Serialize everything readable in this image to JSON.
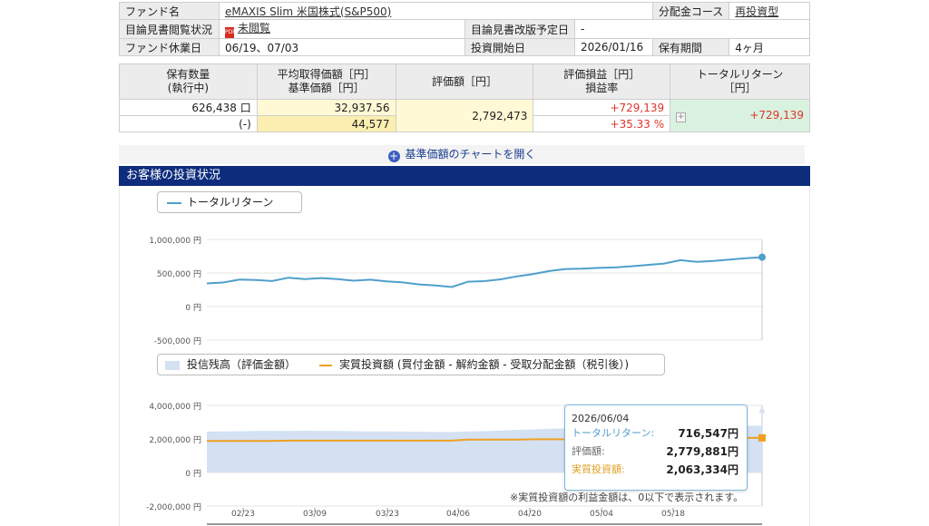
{
  "info": {
    "fund_name_label": "ファンド名",
    "fund_name": "eMAXIS Slim 米国株式(S&P500)",
    "dist_label": "分配金コース",
    "dist_value": "再投資型",
    "prospectus_label": "目論見書閲覧状況",
    "prospectus_status": "未閲覧",
    "revision_label": "目論見書改版予定日",
    "revision_value": "-",
    "holiday_label": "ファンド休業日",
    "holiday_value": "06/19、07/03",
    "start_label": "投資開始日",
    "start_value": "2026/01/16",
    "period_label": "保有期間",
    "period_value": "4ヶ月"
  },
  "holdings": {
    "h_qty1": "保有数量",
    "h_qty2": "(執行中)",
    "h_avg1": "平均取得価額［円］",
    "h_avg2": "基準価額［円］",
    "h_val": "評価額［円］",
    "h_pl1": "評価損益［円］",
    "h_pl2": "損益率",
    "h_tr1": "トータルリターン",
    "h_tr2": "［円］",
    "qty": "626,438 口",
    "pending": "(-)",
    "avg_price": "32,937.56",
    "base_price": "44,577",
    "value": "2,792,473",
    "pl": "+729,139",
    "pl_rate": "+35.33 %",
    "total_return": "+729,139"
  },
  "open_chart_label": "基準価額のチャートを開く",
  "section_title": "お客様の投資状況",
  "legend1": "トータルリターン",
  "legend2_a": "投信残高（評価金額）",
  "legend2_b": "実質投資額 (買付金額 - 解約金額 - 受取分配金額（税引後）)",
  "tooltip": {
    "date": "2026/06/04",
    "tr_label": "トータルリターン:",
    "tr_value": "716,547円",
    "val_label": "評価額:",
    "val_value": "2,779,881円",
    "inv_label": "実質投資額:",
    "inv_value": "2,063,334円"
  },
  "note": "※実質投資額の利益金額は、0以下で表示されます。",
  "colors": {
    "return_line": "#4f9fcb",
    "balance_fill": "#d3e1f3",
    "invest_line": "#f0a021",
    "header_bar": "#0d2d7c"
  },
  "chart_data": [
    {
      "type": "line",
      "series": [
        {
          "name": "トータルリターン",
          "values": [
            345000,
            358000,
            402000,
            395000,
            380000,
            430000,
            410000,
            425000,
            408000,
            385000,
            400000,
            375000,
            360000,
            330000,
            315000,
            290000,
            370000,
            378000,
            405000,
            450000,
            485000,
            530000,
            560000,
            565000,
            575000,
            582000,
            600000,
            620000,
            640000,
            690000,
            665000,
            680000,
            700000,
            720000,
            735000
          ]
        }
      ],
      "x_tick_labels": [
        "02/23",
        "03/09",
        "03/23",
        "04/06",
        "04/20",
        "05/04",
        "05/18"
      ],
      "y_tick_labels": [
        "1,000,000 円",
        "500,000 円",
        "0 円",
        "-500,000 円"
      ],
      "ylim": [
        -500000,
        1000000
      ]
    },
    {
      "type": "area",
      "series": [
        {
          "name": "投信残高（評価金額）",
          "values": [
            2440000,
            2450000,
            2455000,
            2470000,
            2480000,
            2475000,
            2485000,
            2480000,
            2470000,
            2460000,
            2450000,
            2445000,
            2440000,
            2430000,
            2420000,
            2410000,
            2450000,
            2460000,
            2500000,
            2540000,
            2570000,
            2600000,
            2630000,
            2640000,
            2650000,
            2660000,
            2680000,
            2700000,
            2720000,
            2760000,
            2740000,
            2750000,
            2770000,
            2780000,
            2790000
          ]
        },
        {
          "name": "実質投資額",
          "values": [
            1880000,
            1880000,
            1880000,
            1880000,
            1880000,
            1900000,
            1900000,
            1900000,
            1900000,
            1900000,
            1900000,
            1900000,
            1900000,
            1900000,
            1900000,
            1900000,
            1960000,
            1960000,
            1960000,
            1960000,
            1980000,
            1980000,
            1980000,
            1980000,
            2000000,
            2000000,
            2000000,
            2020000,
            2020000,
            2040000,
            2040000,
            2040000,
            2060000,
            2060000,
            2063334
          ]
        }
      ],
      "x_tick_labels": [
        "02/23",
        "03/09",
        "03/23",
        "04/06",
        "04/20",
        "05/04",
        "05/18"
      ],
      "y_tick_labels": [
        "4,000,000 円",
        "2,000,000 円",
        "0 円",
        "-2,000,000 円"
      ],
      "ylim": [
        -2000000,
        4000000
      ]
    }
  ]
}
